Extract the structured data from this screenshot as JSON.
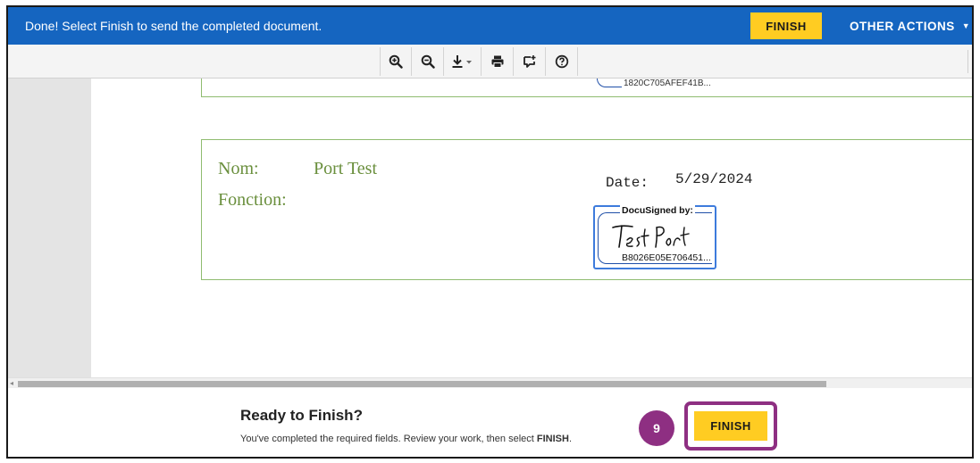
{
  "topbar": {
    "message": "Done! Select Finish to send the completed document.",
    "finish_label": "FINISH",
    "other_actions_label": "OTHER ACTIONS",
    "other_actions_caret": "▼"
  },
  "toolbar": {
    "tools": [
      "zoom-in-icon",
      "zoom-out-icon",
      "download-icon",
      "print-icon",
      "comment-icon",
      "help-icon"
    ]
  },
  "document": {
    "prev_signature_hash": "1820C705AFEF41B...",
    "nom_label": "Nom:",
    "nom_value": "Port Test",
    "fonction_label": "Fonction:",
    "date_label": "Date:",
    "date_value": "5/29/2024",
    "signature": {
      "title": "DocuSigned by:",
      "name": "Test Port",
      "hash": "B8026E05E706451..."
    }
  },
  "footer": {
    "title": "Ready to Finish?",
    "description_prefix": "You've completed the required fields. Review your work, then select ",
    "description_emphasis": "FINISH",
    "description_suffix": ".",
    "step_number": "9",
    "finish_label": "FINISH"
  },
  "colors": {
    "brand_blue": "#1565c0",
    "finish_yellow": "#ffcc22",
    "highlight_purple": "#8e2f82",
    "field_green": "#6a8f3d"
  }
}
